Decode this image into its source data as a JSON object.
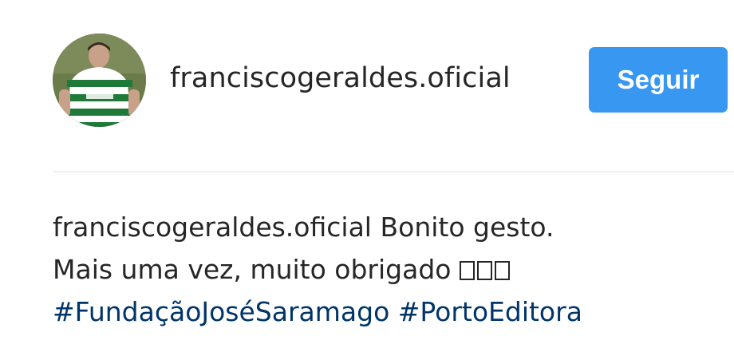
{
  "post": {
    "username": "franciscogeraldes.oficial",
    "follow_label": "Seguir",
    "avatar_icon": "profile-photo",
    "caption": {
      "author": "franciscogeraldes.oficial",
      "text_line1": "Bonito gesto.",
      "text_line2": "Mais uma vez, muito obrigado",
      "unrendered_glyphs": "□□□",
      "hashtags": [
        "#FundaçãoJoséSaramago",
        "#PortoEditora"
      ]
    }
  },
  "colors": {
    "follow_button": "#3897f0",
    "text": "#262626",
    "hashtag": "#003569",
    "divider": "#efefef"
  }
}
